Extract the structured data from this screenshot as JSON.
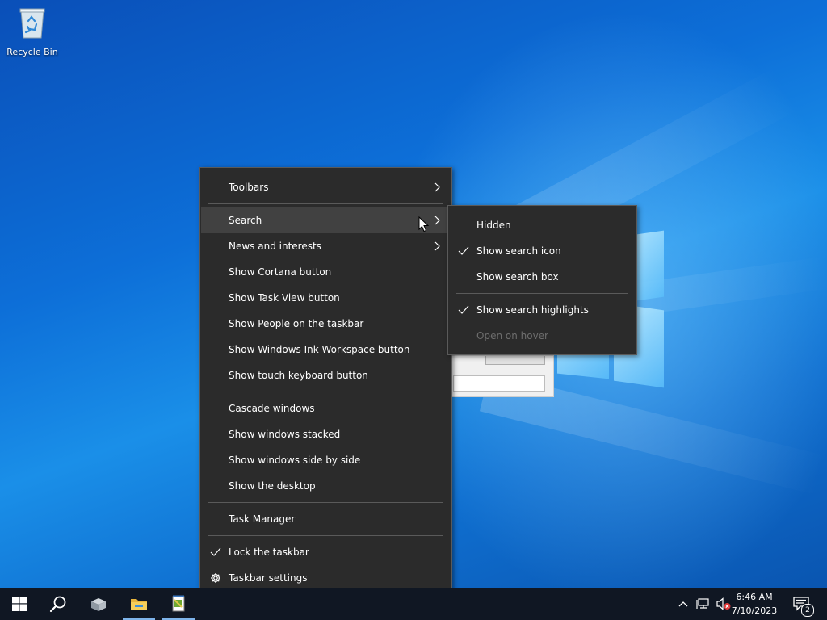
{
  "desktop": {
    "icons": [
      {
        "label": "Recycle Bin",
        "icon": "recycle-bin-icon"
      }
    ]
  },
  "context_menu": {
    "items": [
      {
        "label": "Toolbars",
        "submenu": true
      },
      {
        "separator": true
      },
      {
        "label": "Search",
        "submenu": true,
        "hovered": true
      },
      {
        "label": "News and interests",
        "submenu": true
      },
      {
        "label": "Show Cortana button"
      },
      {
        "label": "Show Task View button"
      },
      {
        "label": "Show People on the taskbar"
      },
      {
        "label": "Show Windows Ink Workspace button"
      },
      {
        "label": "Show touch keyboard button"
      },
      {
        "separator": true
      },
      {
        "label": "Cascade windows"
      },
      {
        "label": "Show windows stacked"
      },
      {
        "label": "Show windows side by side"
      },
      {
        "label": "Show the desktop"
      },
      {
        "separator": true
      },
      {
        "label": "Task Manager"
      },
      {
        "separator": true
      },
      {
        "label": "Lock the taskbar",
        "checked": true
      },
      {
        "label": "Taskbar settings",
        "icon": "gear-icon"
      }
    ]
  },
  "search_submenu": {
    "items": [
      {
        "label": "Hidden"
      },
      {
        "label": "Show search icon",
        "checked": true
      },
      {
        "label": "Show search box"
      },
      {
        "separator": true
      },
      {
        "label": "Show search highlights",
        "checked": true
      },
      {
        "label": "Open on hover",
        "disabled": true
      }
    ]
  },
  "taskbar": {
    "buttons": [
      {
        "name": "start-button",
        "icon": "windows-logo-icon"
      },
      {
        "name": "search-button",
        "icon": "search-icon"
      },
      {
        "name": "app-button",
        "icon": "app-box-icon"
      },
      {
        "name": "file-explorer-button",
        "icon": "folder-icon",
        "running": true
      },
      {
        "name": "notepad-button",
        "icon": "notepad-icon",
        "running": true
      }
    ],
    "tray": {
      "time": "6:46 AM",
      "date": "7/10/2023",
      "notification_count": "2"
    }
  },
  "colors": {
    "menu_bg": "#2b2b2b",
    "menu_hover": "#414141",
    "taskbar_bg": "#101723",
    "disabled_text": "#6d6d6d"
  }
}
